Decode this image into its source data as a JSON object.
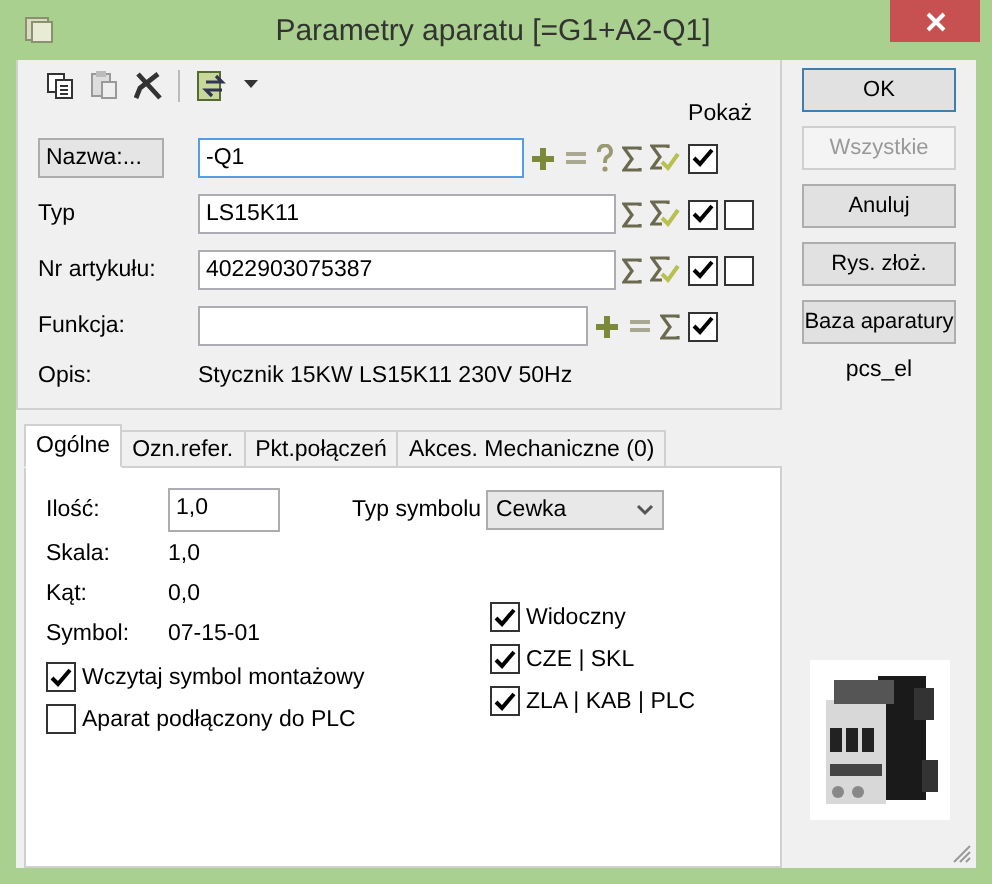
{
  "window": {
    "title": "Parametry aparatu [=G1+A2-Q1]"
  },
  "show_header": "Pokaż",
  "fields": [
    {
      "kind": "button",
      "label": "Nazwa:...",
      "value": "-Q1",
      "focused": true,
      "tools": [
        {
          "kind": "plus"
        },
        {
          "kind": "minus"
        },
        {
          "kind": "help"
        },
        {
          "kind": "sum"
        },
        {
          "kind": "sum-check"
        }
      ],
      "show": true
    },
    {
      "kind": "text",
      "label": "Typ",
      "value": "LS15K11",
      "focused": false,
      "tools": [
        {
          "kind": "sum"
        },
        {
          "kind": "sum-check"
        }
      ],
      "show": true,
      "extra": false
    },
    {
      "kind": "text",
      "label": "Nr artykułu:",
      "value": "4022903075387",
      "focused": false,
      "tools": [
        {
          "kind": "sum"
        },
        {
          "kind": "sum-check"
        }
      ],
      "show": true,
      "extra": false
    },
    {
      "kind": "text",
      "label": "Funkcja:",
      "focused": false,
      "tools": [
        {
          "kind": "plus"
        },
        {
          "kind": "minus"
        },
        {
          "kind": "sum"
        }
      ],
      "show": true
    }
  ],
  "description": {
    "label": "Opis:",
    "value": "Stycznik 15KW LS15K11 230V 50Hz"
  },
  "buttons": [
    {
      "label": "OK",
      "disabled": false,
      "default": true
    },
    {
      "label": "Wszystkie",
      "disabled": true,
      "default": false
    },
    {
      "label": "Anuluj",
      "disabled": false,
      "default": false
    },
    {
      "label": "Rys. złoż.",
      "disabled": false,
      "default": false
    },
    {
      "label": "Baza aparatury",
      "disabled": false,
      "default": false
    }
  ],
  "library": "pcs_el",
  "tabs": [
    {
      "label": "Ogólne",
      "selected": true
    },
    {
      "label": "Ozn.refer.",
      "selected": false
    },
    {
      "label": "Pkt.połączeń",
      "selected": false
    },
    {
      "label": "Akces. Mechaniczne (0)",
      "selected": false
    }
  ],
  "general": {
    "quantity": {
      "label": "Ilość:",
      "value": "1,0"
    },
    "symbol_type": {
      "label": "Typ symbolu",
      "value": "Cewka"
    },
    "info": [
      {
        "label": "Skala:",
        "value": "1,0"
      },
      {
        "label": "Kąt:",
        "value": "0,0"
      },
      {
        "label": "Symbol:",
        "value": "07-15-01"
      }
    ],
    "left_options": [
      {
        "label": "Wczytaj symbol montażowy",
        "checked": true
      },
      {
        "label": "Aparat podłączony do PLC",
        "checked": false
      }
    ],
    "right_options": [
      {
        "label": "Widoczny",
        "checked": true
      },
      {
        "label": "CZE | SKL",
        "checked": true
      },
      {
        "label": "ZLA | KAB | PLC",
        "checked": true
      }
    ]
  }
}
